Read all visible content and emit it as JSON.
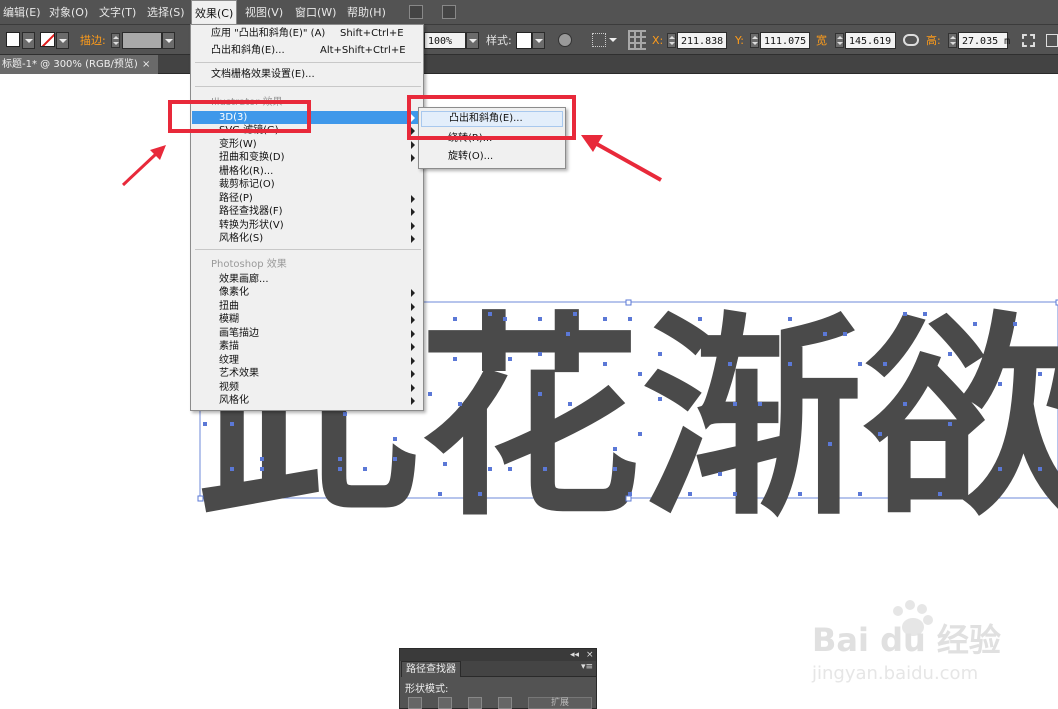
{
  "menubar": {
    "items": [
      "编辑(E)",
      "对象(O)",
      "文字(T)",
      "选择(S)",
      "效果(C)",
      "视图(V)",
      "窗口(W)",
      "帮助(H)"
    ]
  },
  "controlbar": {
    "stroke_label": "描边:",
    "opacity_value": "100%",
    "style_label": "样式:",
    "x_value": "211.838",
    "y_value": "111.075",
    "width_label": "宽",
    "width_value": "145.619",
    "height_label": "高:",
    "height_value": "27.035 m"
  },
  "document": {
    "tab_title": "标题-1* @ 300% (RGB/预览)",
    "tab_close": "×",
    "artwork_text": "此花渐欲",
    "text_color": "#4a4a4a",
    "anchor_color": "#5b78d6"
  },
  "effects_menu": {
    "apply_last": "应用 \"凸出和斜角(E)\" (A)",
    "apply_last_shortcut": "Shift+Ctrl+E",
    "last_effect": "凸出和斜角(E)...",
    "last_effect_shortcut": "Alt+Shift+Ctrl+E",
    "raster_settings": "文档栅格效果设置(E)...",
    "illustrator_header": "Illustrator 效果",
    "illustrator_items": [
      {
        "label": "3D(3)",
        "submenu": true,
        "highlighted": true
      },
      {
        "label": "SVG 滤镜(G)",
        "submenu": true
      },
      {
        "label": "变形(W)",
        "submenu": true
      },
      {
        "label": "扭曲和变换(D)",
        "submenu": true
      },
      {
        "label": "栅格化(R)...",
        "submenu": false
      },
      {
        "label": "裁剪标记(O)",
        "submenu": false
      },
      {
        "label": "路径(P)",
        "submenu": true
      },
      {
        "label": "路径查找器(F)",
        "submenu": true
      },
      {
        "label": "转换为形状(V)",
        "submenu": true
      },
      {
        "label": "风格化(S)",
        "submenu": true
      }
    ],
    "photoshop_header": "Photoshop 效果",
    "photoshop_items": [
      {
        "label": "效果画廊...",
        "submenu": false
      },
      {
        "label": "像素化",
        "submenu": true
      },
      {
        "label": "扭曲",
        "submenu": true
      },
      {
        "label": "模糊",
        "submenu": true
      },
      {
        "label": "画笔描边",
        "submenu": true
      },
      {
        "label": "素描",
        "submenu": true
      },
      {
        "label": "纹理",
        "submenu": true
      },
      {
        "label": "艺术效果",
        "submenu": true
      },
      {
        "label": "视频",
        "submenu": true
      },
      {
        "label": "风格化",
        "submenu": true
      }
    ]
  },
  "submenu_3d": {
    "items": [
      "凸出和斜角(E)...",
      "绕转(R)...",
      "旋转(O)..."
    ]
  },
  "pathfinder": {
    "collapse": "◂◂",
    "close": "×",
    "title": "路径查找器",
    "menu": "▾≡",
    "shape_modes": "形状模式:",
    "expand": "扩展"
  },
  "watermark": {
    "brand": "Bai du 经验",
    "url": "jingyan.baidu.com"
  },
  "annotation_color": "#e8293a"
}
